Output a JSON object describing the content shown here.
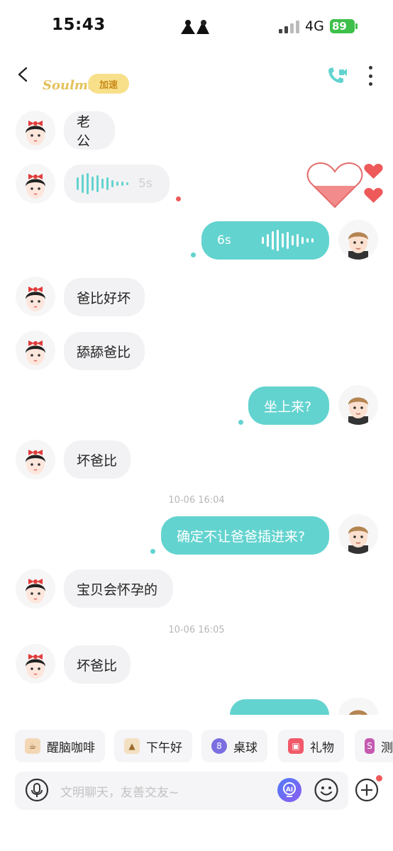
{
  "status_bar": {
    "time": "15:43",
    "network": "4G",
    "battery": "89"
  },
  "header": {
    "logo_text": "Soulmate",
    "logo_badge": "加速"
  },
  "messages": {
    "m1": "老公",
    "m2_duration": "5s",
    "m3_duration": "6s",
    "m4": "爸比好坏",
    "m5": "舔舔爸比",
    "m6": "坐上来?",
    "m7": "坏爸比",
    "ts1": "10-06 16:04",
    "m8": "确定不让爸爸插进来?",
    "m9": "宝贝会怀孕的",
    "ts2": "10-06 16:05",
    "m10": "坏爸比"
  },
  "quick_chips": [
    {
      "label": "醒脑咖啡",
      "icon": "coffee-cup-icon"
    },
    {
      "label": "下午好",
      "icon": "pudding-icon"
    },
    {
      "label": "桌球",
      "icon": "billiard-ball-icon"
    },
    {
      "label": "礼物",
      "icon": "gift-icon"
    },
    {
      "label": "测",
      "icon": "book-icon"
    }
  ],
  "input": {
    "placeholder": "文明聊天，友善交友~"
  },
  "colors": {
    "accent": "#63d3cf",
    "bubble_left": "#f2f2f4",
    "heart": "#ee5a5a",
    "unread_dot": "#ee5a5a"
  }
}
